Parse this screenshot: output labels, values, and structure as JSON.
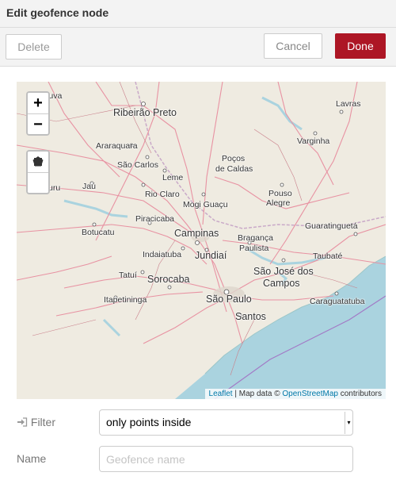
{
  "dialog": {
    "title": "Edit geofence node"
  },
  "toolbar": {
    "delete_label": "Delete",
    "cancel_label": "Cancel",
    "done_label": "Done",
    "done_color": "#ad1625"
  },
  "map": {
    "zoom_in": "+",
    "zoom_out": "−",
    "attribution": {
      "leaflet": "Leaflet",
      "sep": " | Map data © ",
      "osm": "OpenStreetMap",
      "contributors": " contributors"
    },
    "cities": [
      {
        "name": "Ribeirão Preto"
      },
      {
        "name": "Lavras"
      },
      {
        "name": "Araraquara"
      },
      {
        "name": "São Carlos"
      },
      {
        "name": "Varginha"
      },
      {
        "name": "Poços"
      },
      {
        "name": "de Caldas"
      },
      {
        "name": "Leme"
      },
      {
        "name": "Jaú"
      },
      {
        "name": "Rio Claro"
      },
      {
        "name": "Pouso"
      },
      {
        "name": "Alegre"
      },
      {
        "name": "Mogi Guaçu"
      },
      {
        "name": "Piracicaba"
      },
      {
        "name": "Guaratinguetá"
      },
      {
        "name": "Botucatu"
      },
      {
        "name": "Campinas"
      },
      {
        "name": "Bragança"
      },
      {
        "name": "Paulista"
      },
      {
        "name": "Indaiatuba"
      },
      {
        "name": "Jundiaí"
      },
      {
        "name": "Taubaté"
      },
      {
        "name": "Tatuí"
      },
      {
        "name": "São José dos"
      },
      {
        "name": "Campos"
      },
      {
        "name": "Sorocaba"
      },
      {
        "name": "Itapetininga"
      },
      {
        "name": "São Paulo"
      },
      {
        "name": "Caraguatatuba"
      },
      {
        "name": "Santos"
      },
      {
        "name": "tanduva"
      },
      {
        "name": "uru"
      }
    ]
  },
  "form": {
    "filter_label": "Filter",
    "filter_value": "only points inside",
    "name_label": "Name",
    "name_placeholder": "Geofence name"
  }
}
